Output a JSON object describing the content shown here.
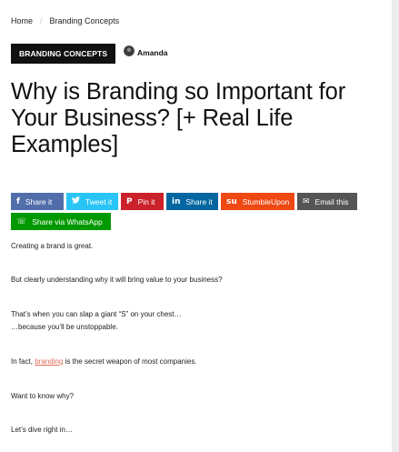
{
  "breadcrumb": {
    "home": "Home",
    "separator": "/",
    "current": "Branding Concepts"
  },
  "category": "BRANDING CONCEPTS",
  "author": {
    "name": "Amanda",
    "avatar_icon": "author-avatar"
  },
  "article": {
    "title": "Why is Branding so Important for Your Business? [+ Real Life Examples]"
  },
  "share": {
    "facebook": {
      "icon": "f",
      "label": "Share it"
    },
    "twitter": {
      "icon": "🐦",
      "label": "Tweet it"
    },
    "pinterest": {
      "icon": "P",
      "label": "Pin it"
    },
    "linkedin": {
      "icon": "in",
      "label": "Share it"
    },
    "stumbleupon": {
      "icon": "su",
      "label": "StumbleUpon"
    },
    "email": {
      "icon": "✉",
      "label": "Email this"
    },
    "whatsapp": {
      "icon": "☏",
      "label": "Share via WhatsApp"
    },
    "colors": {
      "facebook": "#516eab",
      "twitter": "#29c5f6",
      "pinterest": "#ca212a",
      "linkedin": "#0266a0",
      "stumbleupon": "#ee4813",
      "email": "#555555",
      "whatsapp": "#009900"
    }
  },
  "body": {
    "p1": "Creating a brand is great.",
    "p2": "But clearly understanding why it will bring value to your business?",
    "p3a": "That’s when you can slap a giant “S” on your chest…",
    "p3b": "…because you’ll be unstoppable.",
    "p4_pre": "In fact, ",
    "p4_link": "branding",
    "p4_post": " is the secret weapon of most companies.",
    "p5": "Want to know why?",
    "p6": "Let’s dive right in…",
    "link_color": "#e26b5a"
  }
}
